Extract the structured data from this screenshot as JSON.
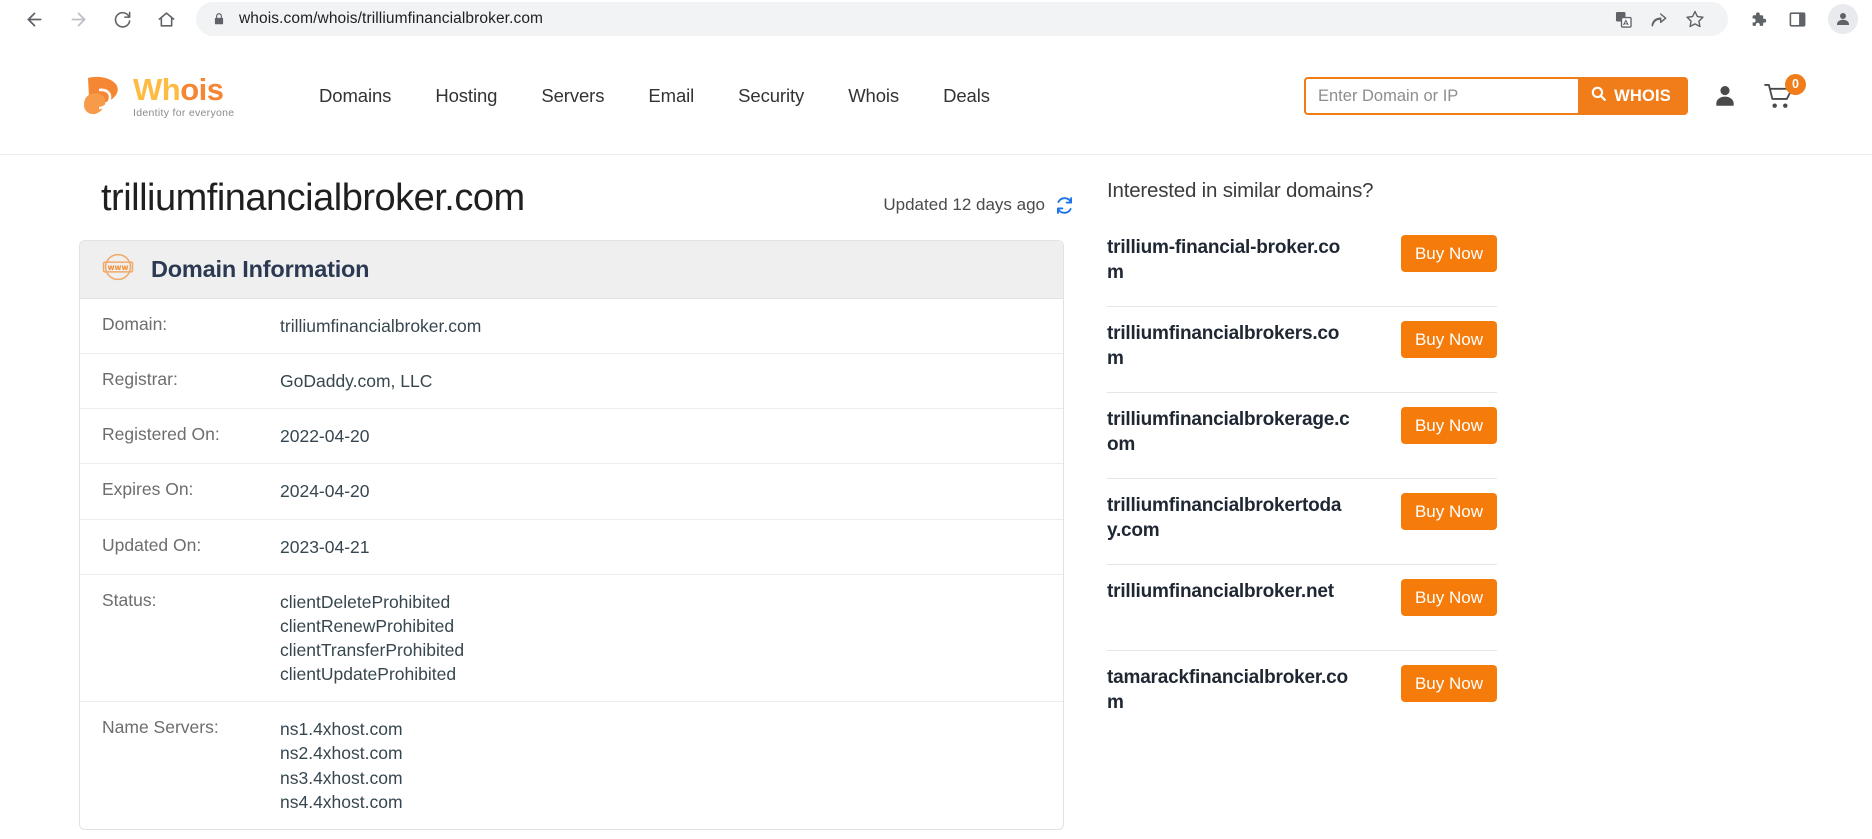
{
  "browser": {
    "url": "whois.com/whois/trilliumfinancialbroker.com",
    "back_label": "Back",
    "forward_label": "Forward",
    "reload_label": "Reload",
    "home_label": "Home",
    "icons": {
      "lock": "lock-icon",
      "translate": "translate-icon",
      "share": "share-icon",
      "bookmark": "star-icon",
      "extensions": "puzzle-icon",
      "side_panel": "side-panel-icon",
      "profile": "profile-avatar-icon"
    }
  },
  "site_header": {
    "logo": {
      "word_part1": "Wh",
      "word_part2": "ois",
      "tagline": "Identity for everyone"
    },
    "nav": [
      {
        "label": "Domains"
      },
      {
        "label": "Hosting"
      },
      {
        "label": "Servers"
      },
      {
        "label": "Email"
      },
      {
        "label": "Security"
      },
      {
        "label": "Whois"
      },
      {
        "label": "Deals"
      }
    ],
    "search": {
      "placeholder": "Enter Domain or IP",
      "value": "",
      "button_label": "WHOIS"
    },
    "cart_count": "0"
  },
  "main": {
    "domain_title": "trilliumfinancialbroker.com",
    "updated_text": "Updated 12 days ago",
    "card_title": "Domain Information",
    "rows": [
      {
        "label": "Domain:",
        "values": [
          "trilliumfinancialbroker.com"
        ]
      },
      {
        "label": "Registrar:",
        "values": [
          "GoDaddy.com, LLC"
        ]
      },
      {
        "label": "Registered On:",
        "values": [
          "2022-04-20"
        ]
      },
      {
        "label": "Expires On:",
        "values": [
          "2024-04-20"
        ]
      },
      {
        "label": "Updated On:",
        "values": [
          "2023-04-21"
        ]
      },
      {
        "label": "Status:",
        "values": [
          "clientDeleteProhibited",
          "clientRenewProhibited",
          "clientTransferProhibited",
          "clientUpdateProhibited"
        ]
      },
      {
        "label": "Name Servers:",
        "values": [
          "ns1.4xhost.com",
          "ns2.4xhost.com",
          "ns3.4xhost.com",
          "ns4.4xhost.com"
        ]
      }
    ]
  },
  "sidebar": {
    "title": "Interested in similar domains?",
    "buy_label": "Buy Now",
    "items": [
      {
        "name": "trillium-financial-broker.com"
      },
      {
        "name": "trilliumfinancialbrokers.com"
      },
      {
        "name": "trilliumfinancialbrokerage.com"
      },
      {
        "name": "trilliumfinancialbrokertoday.com"
      },
      {
        "name": "trilliumfinancialbroker.net"
      },
      {
        "name": "tamarackfinancialbroker.com"
      }
    ]
  },
  "colors": {
    "brand_orange": "#f07d1a",
    "buy_orange": "#f57c0a",
    "logo_yellow": "#fdbb42",
    "refresh_blue": "#1a73e8",
    "card_header_bg": "#efefef"
  }
}
